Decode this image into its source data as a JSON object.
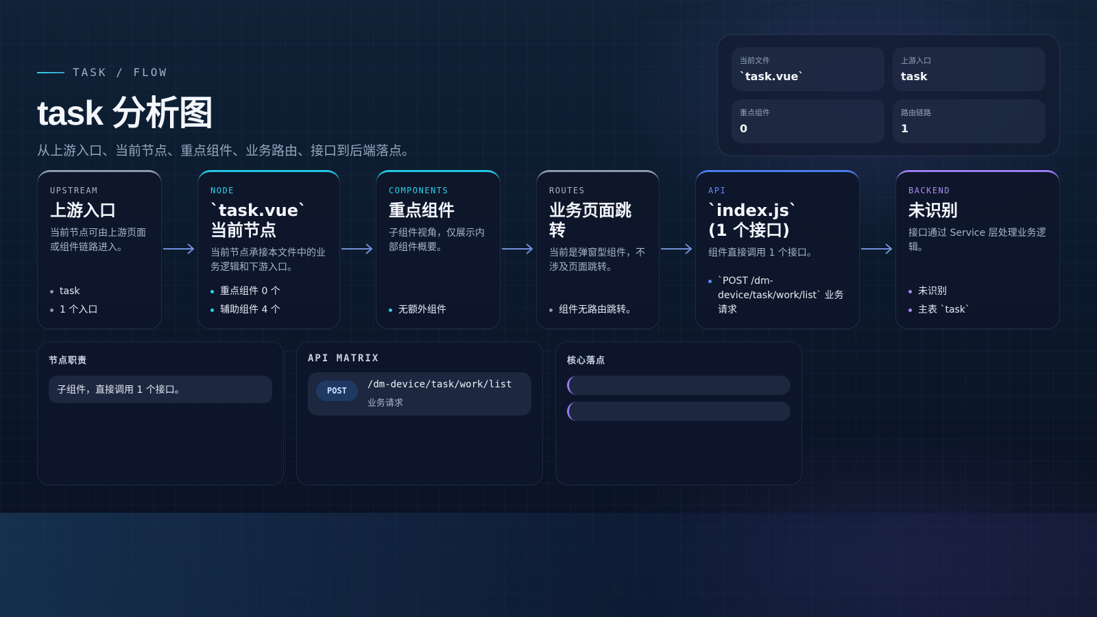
{
  "header": {
    "eyebrow": "TASK / FLOW",
    "title": "task 分析图",
    "subtitle": "从上游入口、当前节点、重点组件、业务路由、接口到后端落点。"
  },
  "stats": [
    {
      "label": "当前文件",
      "value": "`task.vue`"
    },
    {
      "label": "上游入口",
      "value": "task"
    },
    {
      "label": "重点组件",
      "value": "0"
    },
    {
      "label": "路由链路",
      "value": "1"
    }
  ],
  "cards": [
    {
      "kicker": "UPSTREAM",
      "title": "上游入口",
      "desc": "当前节点可由上游页面或组件链路进入。",
      "items": [
        "task",
        "1 个入口"
      ],
      "accent": "#8e99ab",
      "kicker_color": "#a9b4c4",
      "dot": "#8e99ab"
    },
    {
      "kicker": "NODE",
      "title": "`task.vue`\n当前节点",
      "desc": "当前节点承接本文件中的业务逻辑和下游入口。",
      "items": [
        "重点组件 0 个",
        "辅助组件 4 个"
      ],
      "accent": "#22c8e6",
      "kicker_color": "#2bd3e8",
      "dot": "#2bd3e8"
    },
    {
      "kicker": "COMPONENTS",
      "title": "重点组件",
      "desc": "子组件视角，仅展示内部组件概要。",
      "items": [
        "无额外组件"
      ],
      "accent": "#22c8e6",
      "kicker_color": "#2bd3e8",
      "dot": "#2bd3e8"
    },
    {
      "kicker": "ROUTES",
      "title": "业务页面跳转",
      "desc": "当前是弹窗型组件，不涉及页面跳转。",
      "items": [
        "组件无路由跳转。"
      ],
      "accent": "#8e99ab",
      "kicker_color": "#a9b4c4",
      "dot": "#8e99ab"
    },
    {
      "kicker": "API",
      "title": "`index.js`\n(1 个接口)",
      "desc": "组件直接调用 1 个接口。",
      "items": [
        "`POST /dm-device/task/work/list` 业务请求"
      ],
      "accent": "#4a7cf0",
      "kicker_color": "#5b8ff5",
      "dot": "#5b8ff5"
    },
    {
      "kicker": "BACKEND",
      "title": "未识别",
      "desc": "接口通过 Service 层处理业务逻辑。",
      "items": [
        "未识别",
        "主表 `task`"
      ],
      "accent": "#9b7cf0",
      "kicker_color": "#a98bf5",
      "dot": "#a98bf5"
    }
  ],
  "panels": {
    "duty": {
      "title": "节点职责",
      "text": "子组件，直接调用 1 个接口。"
    },
    "api_matrix": {
      "title": "API MATRIX",
      "method": "POST",
      "path": "/dm-device/task/work/list",
      "note": "业务请求"
    },
    "landing": {
      "title": "核心落点"
    }
  }
}
